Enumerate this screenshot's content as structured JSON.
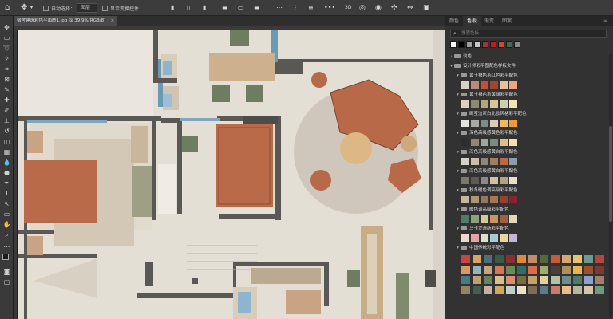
{
  "options_bar": {
    "auto_select_label": "自动选择：",
    "layer_select": "图层",
    "show_transform_label": "显示变换控件"
  },
  "document": {
    "tab_title": "宿舍建筑彩色平面图1.jpg @ 39.9%(RGB/8)",
    "close_glyph": "×"
  },
  "panel": {
    "tabs": [
      "颜色",
      "色板",
      "渐变",
      "图案"
    ],
    "active_tab": 1,
    "search_placeholder": "搜索色板",
    "recent_colors": [
      "#ffffff",
      "#000000",
      "#9e9e9e",
      "#c7c7c7",
      "#b03030",
      "#d01818",
      "#cf4a2a",
      "#3c6b4f",
      "#8a8a8a"
    ],
    "groups": [
      {
        "name": "淡色",
        "expanded": false,
        "level": 0
      },
      {
        "name": "设计师彩平图配色样板文件",
        "expanded": true,
        "level": 0,
        "children": [
          {
            "name": "黄土褐色系红色彩平配色",
            "swatches": [
              "#dcd2c3",
              "#b78b7d",
              "#c0503a",
              "#9b4733",
              "#e7bf9c",
              "#f0a57c"
            ]
          },
          {
            "name": "黄土褐色系黄绿彩平配色",
            "swatches": [
              "#ddd1c0",
              "#8c8a73",
              "#b6a67c",
              "#d7c699",
              "#c8d1a7",
              "#f1e3b3"
            ]
          },
          {
            "name": "卧室淡灰白北欧风格彩平配色",
            "swatches": [
              "#e4e2dc",
              "#a9aaa3",
              "#7c8a8a",
              "#d9cfb8",
              "#f3ba5a",
              "#f39b32"
            ]
          },
          {
            "name": "深色高级感黄色彩平配色",
            "swatches": [
              "#2d2d2d",
              "#8e8671",
              "#a1a59f",
              "#7b8a80",
              "#d8c288",
              "#f1e0b1"
            ]
          },
          {
            "name": "深色高级感黄白彩平配色",
            "swatches": [
              "#d8d2c5",
              "#c9c0a9",
              "#8b8777",
              "#9d8064",
              "#b96a43",
              "#8e9cab"
            ]
          },
          {
            "name": "深色高级感黄白彩平配色",
            "swatches": [
              "#7e776d",
              "#5e5a55",
              "#8a8b86",
              "#d1c2a4",
              "#b5a27d",
              "#e9dfcc"
            ]
          },
          {
            "name": "秋冬暖色调高级彩平配色",
            "swatches": [
              "#c7b89c",
              "#b09474",
              "#8f7a5f",
              "#a7774f",
              "#9a3f2d",
              "#8b2230"
            ]
          },
          {
            "name": "暖色调高级彩平配色",
            "swatches": [
              "#4d7d63",
              "#8fa07d",
              "#d7c895",
              "#c89560",
              "#a25f3c",
              "#e4d7b8"
            ]
          },
          {
            "name": "马卡龙清新彩平配色",
            "swatches": [
              "#f1d6d0",
              "#e3a3a3",
              "#d5e3c8",
              "#a7c8d8",
              "#e8d59a",
              "#c6b6d6"
            ]
          },
          {
            "name": "中国传统彩平配色",
            "swatches": []
          }
        ]
      }
    ],
    "traditional_grid": [
      "#c8443c",
      "#d7a65a",
      "#4d6f7a",
      "#355d4b",
      "#8f2d2d",
      "#e08b3c",
      "#c48d6a",
      "#4f6b3a",
      "#c65a39",
      "#d7a86d",
      "#e4c56c",
      "#6b9a8e",
      "#b3473d",
      "#d59b62",
      "#8fb6c3",
      "#c9a57c",
      "#d8745a",
      "#6d8a51",
      "#2c6e6a",
      "#de6b48",
      "#99b06b",
      "#4b3f37",
      "#b08f5b",
      "#e9b64a",
      "#9f4f2e",
      "#7b3b32",
      "#457b84",
      "#c2a06b",
      "#68835d",
      "#d8c08c",
      "#da8c74",
      "#7b6c3b",
      "#c5a26a",
      "#e2d0a0",
      "#aec4a2",
      "#6c8c8f",
      "#4e7a6a",
      "#8ea1c8",
      "#a57e66",
      "#92865f",
      "#3f6155",
      "#c7b0a0",
      "#d1a95b",
      "#bfd0c9",
      "#e9e2c5",
      "#7e6d55",
      "#5a7c8c",
      "#c97c6a",
      "#e7bd8a",
      "#b2b99a",
      "#d0c8a7",
      "#6e9b7f"
    ]
  }
}
